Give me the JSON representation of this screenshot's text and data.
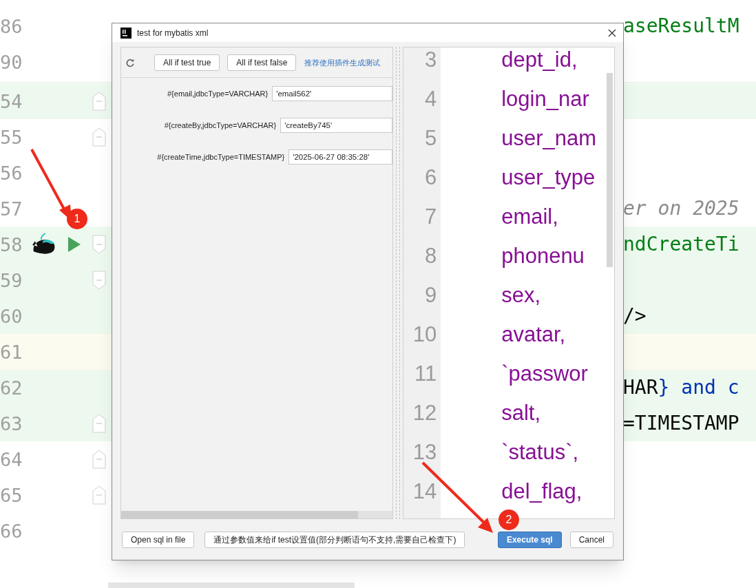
{
  "editor": {
    "lines": [
      {
        "number": "86",
        "added": false,
        "current": false,
        "tokens": [
          {
            "text": "aseResultM",
            "kind": "string"
          }
        ]
      },
      {
        "number": "90",
        "added": false,
        "current": false
      },
      {
        "number": "54",
        "added": true,
        "current": false
      },
      {
        "number": "55",
        "added": false,
        "current": false
      },
      {
        "number": "56",
        "added": false,
        "current": false
      },
      {
        "number": "57",
        "added": false,
        "current": false,
        "tokens": [
          {
            "text": "er on 2025",
            "kind": "comment"
          }
        ]
      },
      {
        "number": "58",
        "added": true,
        "current": false,
        "tokens": [
          {
            "text": "ndCreateTi",
            "kind": "string"
          }
        ]
      },
      {
        "number": "59",
        "added": true,
        "current": false
      },
      {
        "number": "60",
        "added": true,
        "current": false,
        "tokens": [
          {
            "text": "/>",
            "kind": "plain"
          }
        ]
      },
      {
        "number": "61",
        "added": false,
        "current": true
      },
      {
        "number": "62",
        "added": true,
        "current": false,
        "tokens": [
          {
            "text": "HAR",
            "kind": "plain"
          },
          {
            "text": "} and c",
            "kind": "keyword"
          }
        ]
      },
      {
        "number": "63",
        "added": true,
        "current": false,
        "tokens": [
          {
            "text": "=TIMESTAMP",
            "kind": "plain"
          }
        ]
      },
      {
        "number": "64",
        "added": false,
        "current": false
      },
      {
        "number": "65",
        "added": false,
        "current": false
      },
      {
        "number": "66",
        "added": false,
        "current": false
      }
    ]
  },
  "dialog": {
    "title": "test for mybatis xml",
    "toolbar": {
      "buttons": [
        "All if test true",
        "All if test false"
      ],
      "link": "推荐使用插件生成测试"
    },
    "params": [
      {
        "label": "#{email,jdbcType=VARCHAR}",
        "value": "'email562'"
      },
      {
        "label": "#{createBy,jdbcType=VARCHAR}",
        "value": "'createBy745'"
      },
      {
        "label": "#{createTime,jdbcType=TIMESTAMP}",
        "value": "'2025-06-27 08:35:28'"
      }
    ],
    "sql_lines": [
      {
        "number": "3",
        "text": "dept_id,"
      },
      {
        "number": "4",
        "text": "login_nar"
      },
      {
        "number": "5",
        "text": "user_nam"
      },
      {
        "number": "6",
        "text": "user_type"
      },
      {
        "number": "7",
        "text": "email,"
      },
      {
        "number": "8",
        "text": "phonenu"
      },
      {
        "number": "9",
        "text": "sex,"
      },
      {
        "number": "10",
        "text": "avatar,"
      },
      {
        "number": "11",
        "text": "`passwor"
      },
      {
        "number": "12",
        "text": "salt,"
      },
      {
        "number": "13",
        "text": "`status`,"
      },
      {
        "number": "14",
        "text": "del_flag,"
      }
    ],
    "footer": {
      "left_buttons": [
        "Open sql in file",
        "通过参数值来给if test设置值(部分判断语句不支持,需要自己检查下)"
      ],
      "right_buttons": [
        {
          "label": "Execute sql",
          "primary": true
        },
        {
          "label": "Cancel",
          "primary": false
        }
      ]
    }
  },
  "annotations": [
    {
      "label": "1"
    },
    {
      "label": "2"
    }
  ]
}
